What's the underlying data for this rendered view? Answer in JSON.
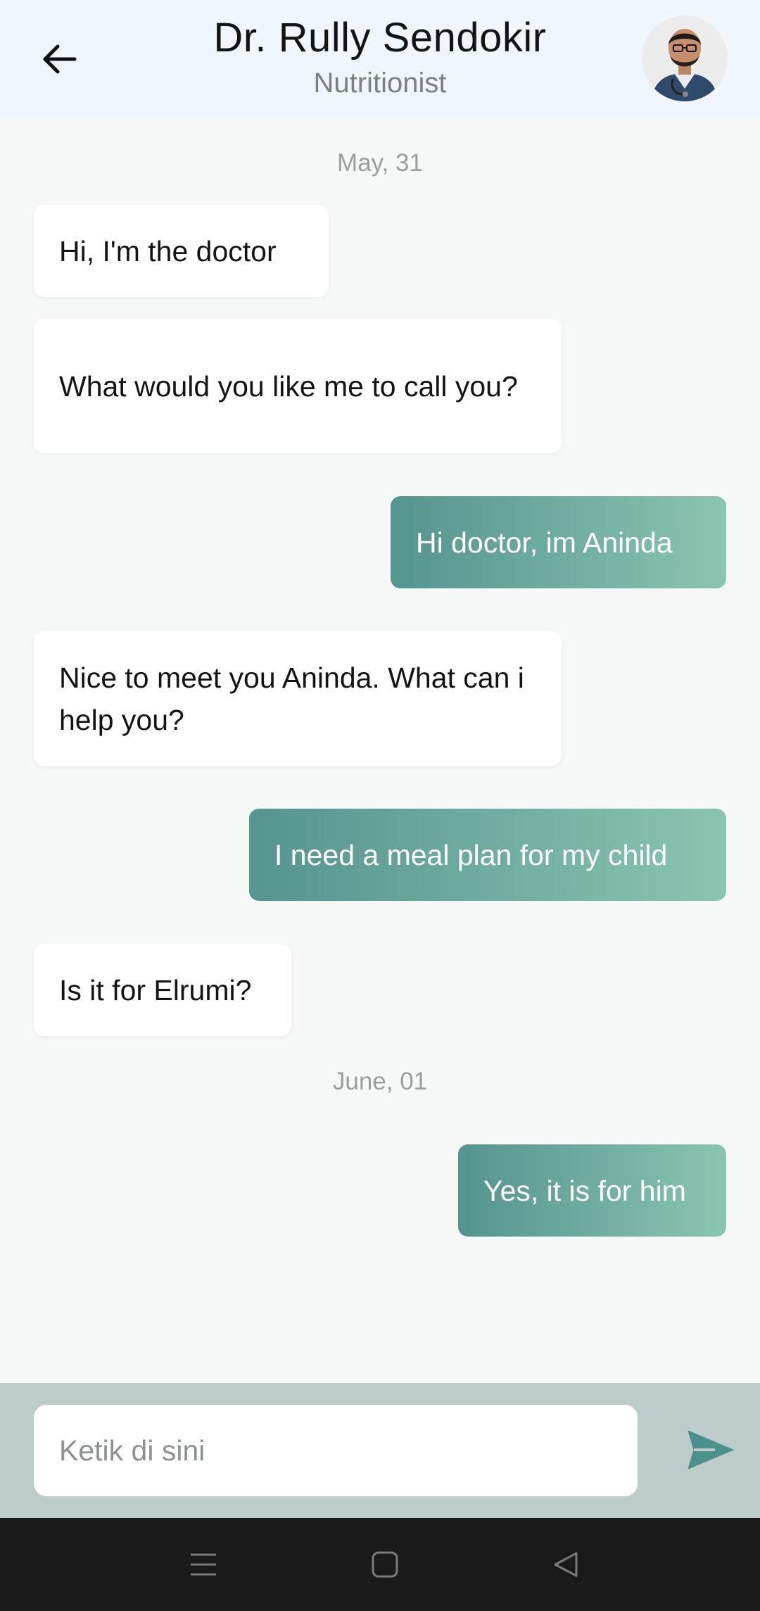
{
  "header": {
    "title": "Dr. Rully Sendokir",
    "subtitle": "Nutritionist"
  },
  "dates": {
    "first": "May, 31",
    "second": "June, 01"
  },
  "messages": [
    {
      "side": "in",
      "text": "Hi, I'm the doctor"
    },
    {
      "side": "in",
      "text": "What would you like me to call you?"
    },
    {
      "side": "out",
      "text": "Hi doctor, im Aninda"
    },
    {
      "side": "in",
      "text": "Nice to meet you Aninda. What can i help you?"
    },
    {
      "side": "out",
      "text": "I need a meal plan for my child"
    },
    {
      "side": "in",
      "text": "Is it for Elrumi?"
    },
    {
      "side": "out",
      "text": "Yes, it is for him"
    }
  ],
  "composer": {
    "placeholder": "Ketik di sini",
    "value": ""
  },
  "icons": {
    "back": "arrow-left-icon",
    "send": "send-icon",
    "nav_menu": "menu-icon",
    "nav_home": "home-icon",
    "nav_back": "back-triangle-icon"
  },
  "colors": {
    "header_bg": "#f1f6fe",
    "chat_bg": "#f6f8f8",
    "outgoing_start": "#55948f",
    "outgoing_end": "#8ac5b1",
    "send_icon": "#4a918c",
    "composer_bg": "#bccccb",
    "navbar_bg": "#1a1a1a"
  }
}
